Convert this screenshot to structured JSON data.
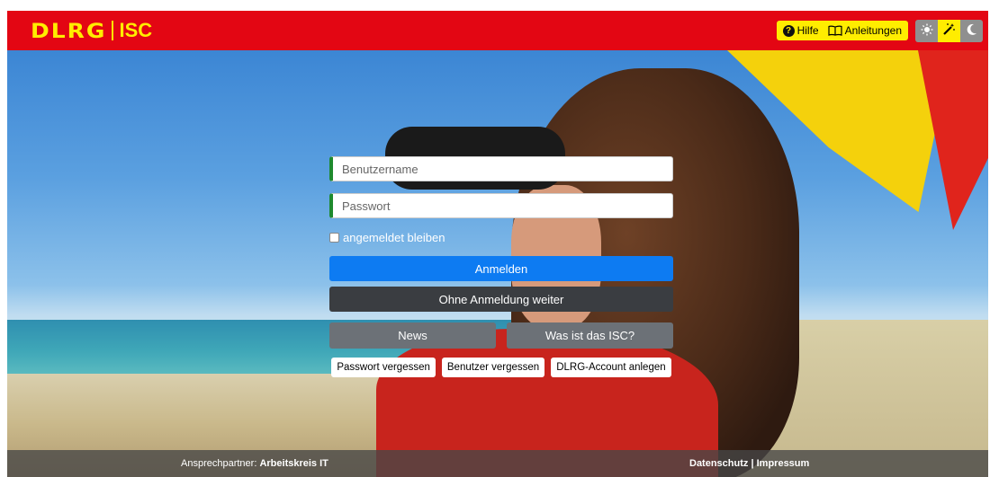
{
  "header": {
    "logo_main": "DLRG",
    "logo_sub": "ISC",
    "help_label": "Hilfe",
    "guides_label": "Anleitungen",
    "theme_buttons": [
      "light-mode-icon",
      "auto-mode-icon",
      "dark-mode-icon"
    ],
    "active_theme": "auto",
    "colors": {
      "brand_red": "#e30613",
      "brand_yellow": "#ffed00"
    }
  },
  "login": {
    "username_placeholder": "Benutzername",
    "password_placeholder": "Passwort",
    "remember_label": "angemeldet bleiben",
    "login_button": "Anmelden",
    "continue_button": "Ohne Anmeldung weiter",
    "news_button": "News",
    "about_button": "Was ist das ISC?",
    "forgot_password": "Passwort vergessen",
    "forgot_user": "Benutzer vergessen",
    "create_account": "DLRG-Account anlegen"
  },
  "footer": {
    "contact_prefix": "Ansprechpartner:",
    "contact_name": "Arbeitskreis IT",
    "privacy": "Datenschutz",
    "separator": "|",
    "imprint": "Impressum"
  }
}
